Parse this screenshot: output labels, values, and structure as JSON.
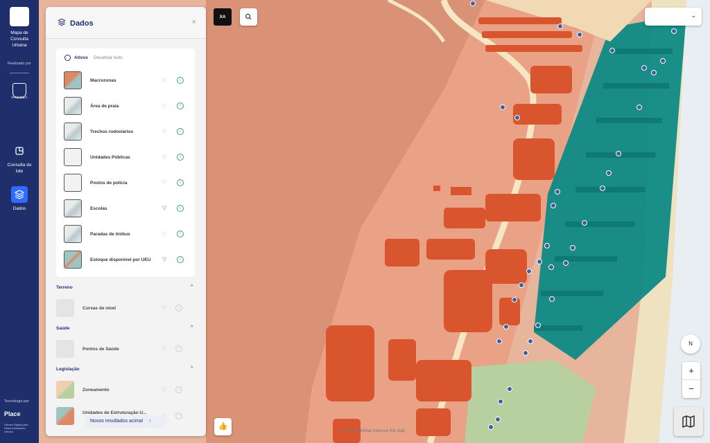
{
  "sidebar": {
    "app_title_line1": "Mapa de",
    "app_title_line2": "Consulta",
    "app_title_line3": "Urbana",
    "made_by": "Realizado por",
    "crest_label": "ZAMORILA",
    "nav": [
      {
        "label_line1": "Consulta do",
        "label_line2": "lote",
        "icon": "parcel-icon"
      },
      {
        "label_line1": "Dados",
        "label_line2": "",
        "icon": "layers-icon",
        "active": true
      }
    ],
    "tech_by": "Tecnologia por",
    "brand": "Place",
    "brand_sub_1": "Gêmeo Digital para",
    "brand_sub_2": "Desenvolvimento",
    "brand_sub_3": "Urbano"
  },
  "panel": {
    "title": "Dados",
    "close": "×",
    "tab_active": "Ativos",
    "tab_action": "Desativar tudo",
    "active_layers": [
      {
        "label": "Macrozonas"
      },
      {
        "label": "Área de praia"
      },
      {
        "label": "Trechos rodoviários"
      },
      {
        "label": "Unidades Públicas"
      },
      {
        "label": "Postos de polícia"
      },
      {
        "label": "Escolas"
      },
      {
        "label": "Paradas de ônibus"
      },
      {
        "label": "Estoque disponível por UEU"
      }
    ],
    "sections": [
      {
        "title": "Terreno",
        "items": [
          {
            "label": "Curvas de nível"
          }
        ]
      },
      {
        "title": "Saúde",
        "items": [
          {
            "label": "Pontos de Saúde"
          }
        ]
      },
      {
        "title": "Legislação",
        "items": [
          {
            "label": "Zoneamento"
          },
          {
            "label": "Unidades de Estruturação U..."
          }
        ]
      }
    ],
    "toast": "Novos resultados acima!"
  },
  "map": {
    "xa_button": "XA",
    "compass": "N",
    "zoom_in": "+",
    "zoom_out": "−",
    "attribution": "© OpenStreetMap Improve this map",
    "colors": {
      "zone_main": "#e8a085",
      "zone_dark": "#d99276",
      "buildings_orange": "#d9552e",
      "buildings_teal": "#0e8a84",
      "buildings_green": "#b8cfa0",
      "beach": "#efe2c0",
      "sea": "#e9eef2",
      "road": "#f7e6c4",
      "sidebar": "#1f2f6b",
      "accent": "#2f6bff"
    }
  }
}
